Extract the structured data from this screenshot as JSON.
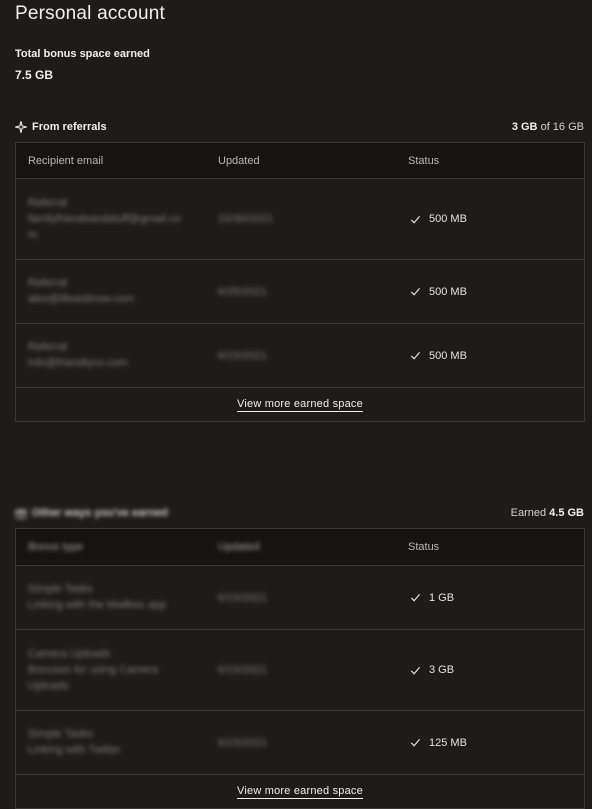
{
  "page": {
    "title": "Personal account",
    "total_label": "Total bonus space earned",
    "total_value": "7.5 GB"
  },
  "referrals": {
    "title": "From referrals",
    "icon": "sparkle-icon",
    "summary_bold": "3 GB",
    "summary_rest": " of 16 GB",
    "columns": [
      "Recipient email",
      "Updated",
      "Status"
    ],
    "rows": [
      {
        "name": "Referral",
        "email": "familyfriendsandstuff@gmail.co",
        "email_cont": "m",
        "updated": "10/30/2021",
        "status": "500 MB"
      },
      {
        "name": "Referral",
        "email": "alex@lifeasitnow.com",
        "email_cont": "",
        "updated": "6/25/2021",
        "status": "500 MB"
      },
      {
        "name": "Referral",
        "email": "info@friendlyco.com",
        "email_cont": "",
        "updated": "6/15/2021",
        "status": "500 MB"
      }
    ],
    "more_link": "View more earned space"
  },
  "other": {
    "title": "Other ways you've earned",
    "icon": "gift-icon",
    "summary_rest": "Earned ",
    "summary_bold": "4.5 GB",
    "columns": [
      "Bonus type",
      "Updated",
      "Status"
    ],
    "rows": [
      {
        "name": "Simple Tasks",
        "desc": "Linking with the Mailbox app",
        "desc_cont": "",
        "updated": "6/15/2021",
        "status": "1 GB"
      },
      {
        "name": "Camera Uploads",
        "desc": "Bonuses for using Camera",
        "desc_cont": "Uploads",
        "updated": "6/15/2021",
        "status": "3 GB"
      },
      {
        "name": "Simple Tasks",
        "desc": "Linking with Twitter",
        "desc_cont": "",
        "updated": "6/15/2021",
        "status": "125 MB"
      }
    ],
    "more_link": "View more earned space"
  }
}
